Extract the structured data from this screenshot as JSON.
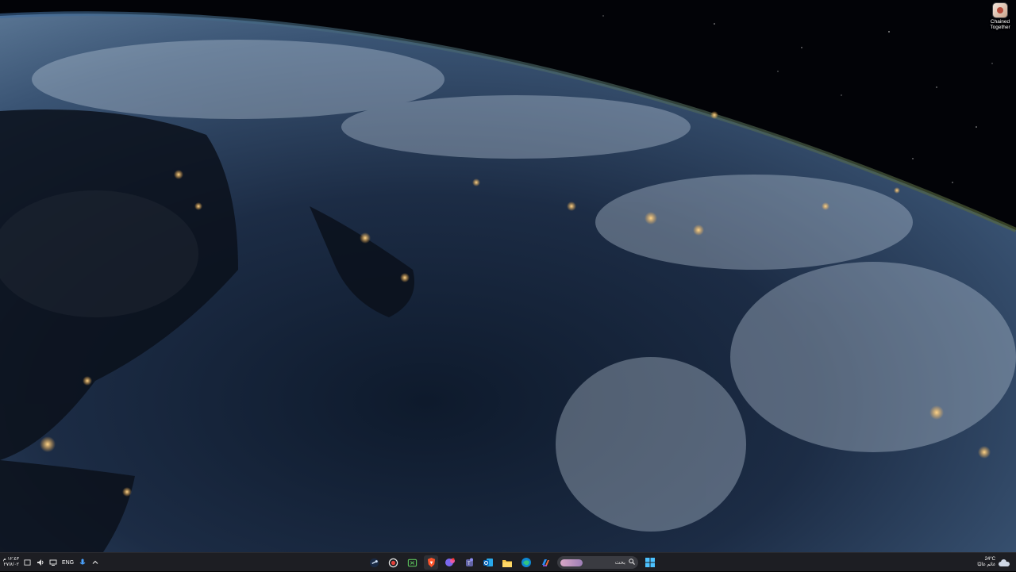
{
  "desktop": {
    "icons": [
      {
        "label_line1": "Chained",
        "label_line2": "Together"
      }
    ]
  },
  "taskbar": {
    "clock": {
      "time": "١٢:٤٣ م",
      "date": "٢٧/٨/٠٢"
    },
    "language": "ENG",
    "search": {
      "placeholder": "بحث"
    },
    "weather": {
      "temp": "24°C",
      "condition": "غائم غالبًا"
    },
    "pinned_apps": [
      "steam-icon",
      "record-icon",
      "xbox-icon",
      "brave-icon",
      "chat-app-icon",
      "teams-icon",
      "outlook-icon",
      "file-explorer-icon",
      "edge-icon",
      "copilot-icon"
    ],
    "start_icon": "windows-start-icon"
  }
}
